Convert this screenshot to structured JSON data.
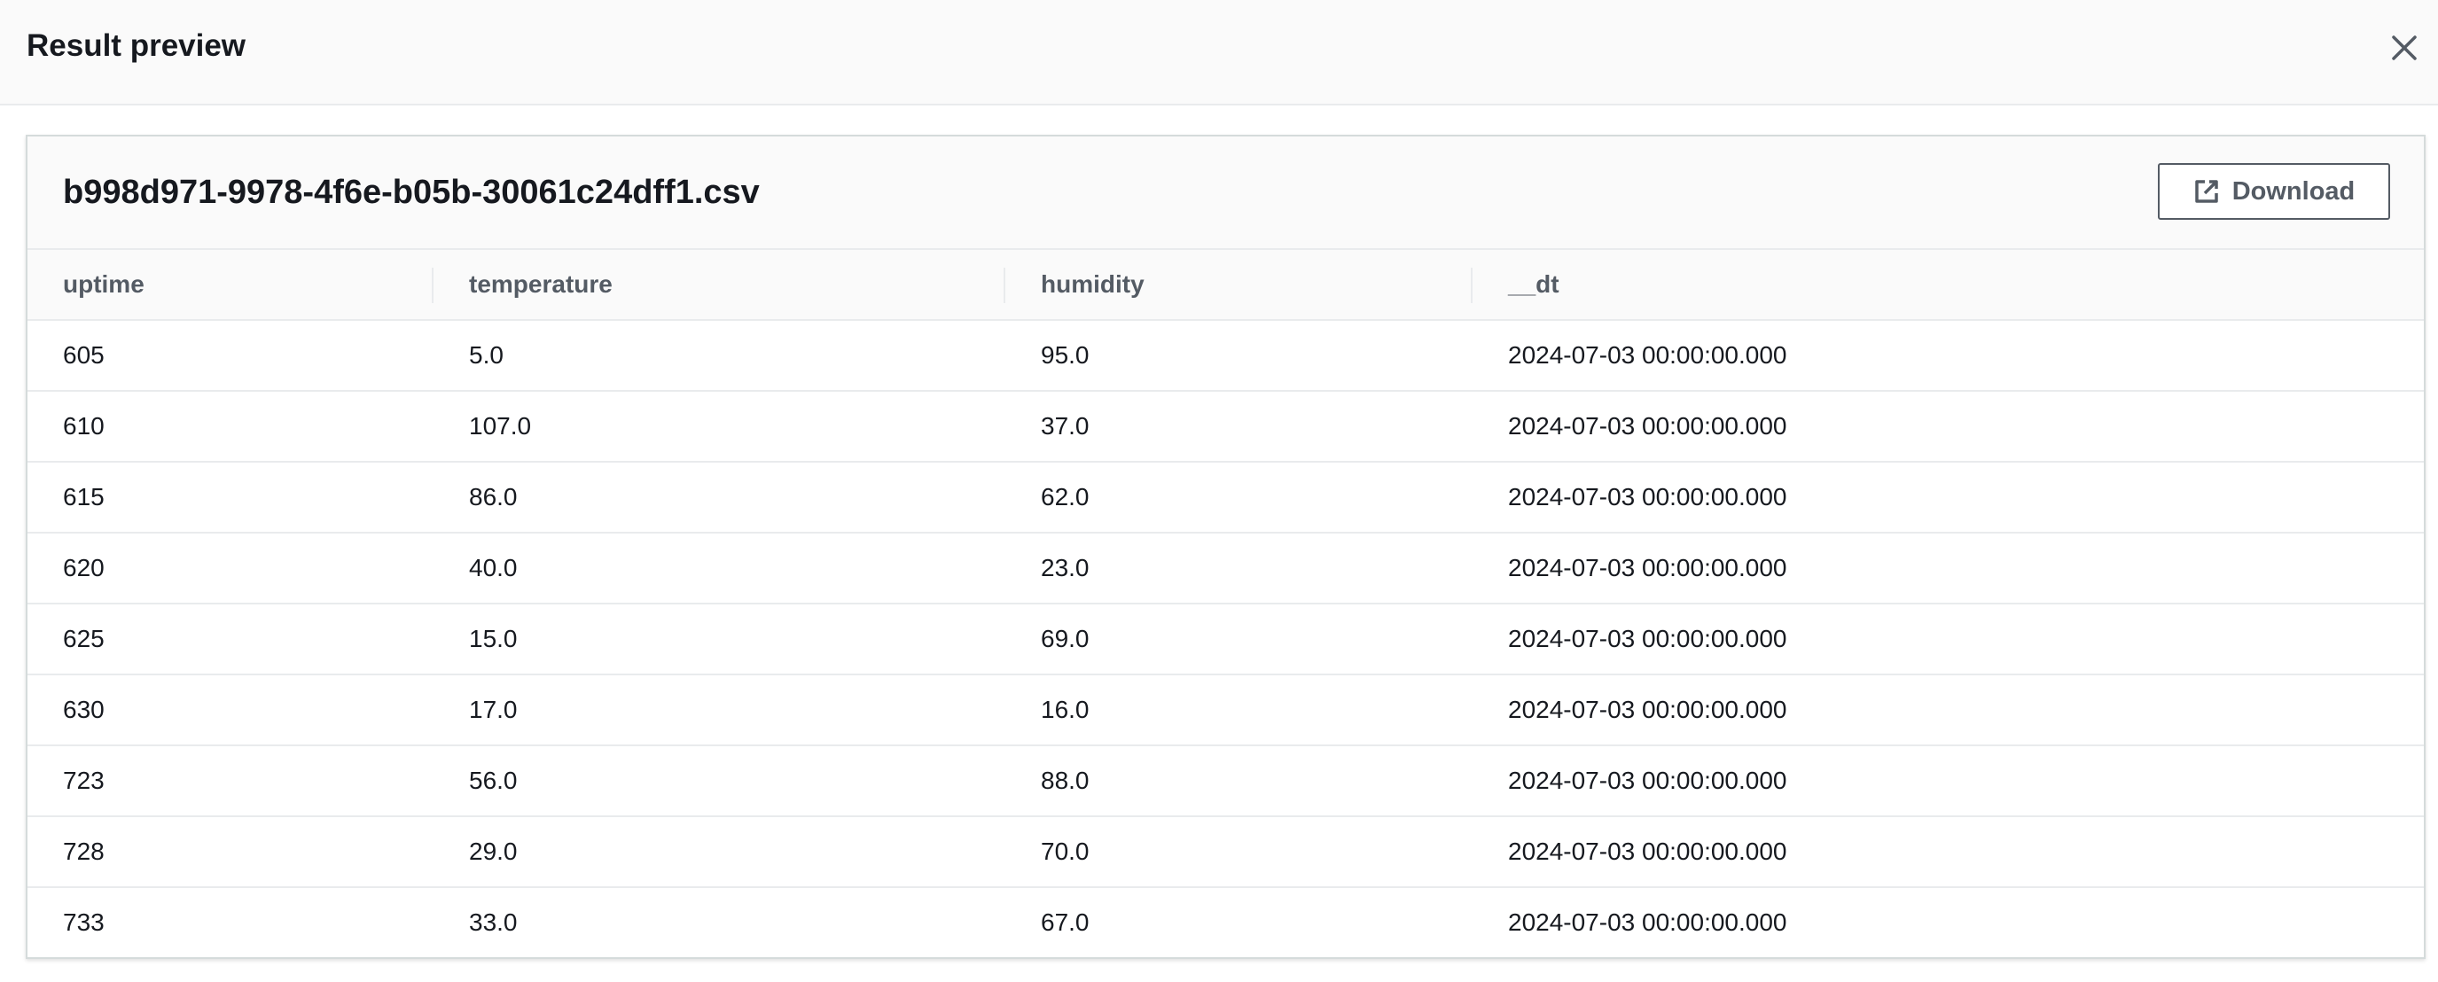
{
  "modal": {
    "title": "Result preview"
  },
  "panel": {
    "file_name": "b998d971-9978-4f6e-b05b-30061c24dff1.csv",
    "download_label": "Download"
  },
  "table": {
    "columns": [
      "uptime",
      "temperature",
      "humidity",
      "__dt"
    ],
    "rows": [
      [
        "605",
        "5.0",
        "95.0",
        "2024-07-03 00:00:00.000"
      ],
      [
        "610",
        "107.0",
        "37.0",
        "2024-07-03 00:00:00.000"
      ],
      [
        "615",
        "86.0",
        "62.0",
        "2024-07-03 00:00:00.000"
      ],
      [
        "620",
        "40.0",
        "23.0",
        "2024-07-03 00:00:00.000"
      ],
      [
        "625",
        "15.0",
        "69.0",
        "2024-07-03 00:00:00.000"
      ],
      [
        "630",
        "17.0",
        "16.0",
        "2024-07-03 00:00:00.000"
      ],
      [
        "723",
        "56.0",
        "88.0",
        "2024-07-03 00:00:00.000"
      ],
      [
        "728",
        "29.0",
        "70.0",
        "2024-07-03 00:00:00.000"
      ],
      [
        "733",
        "33.0",
        "67.0",
        "2024-07-03 00:00:00.000"
      ]
    ]
  },
  "icons": {
    "close": "close-icon",
    "download": "external-link-icon"
  },
  "colors": {
    "text": "#16191f",
    "muted": "#545b64",
    "divider": "#e9ebed",
    "header_bg": "#fafafa"
  }
}
